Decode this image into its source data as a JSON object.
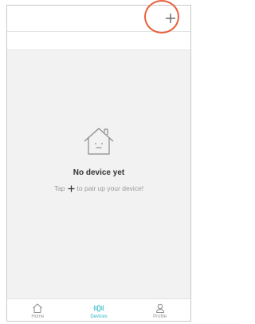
{
  "empty_state": {
    "title": "No device yet",
    "hint_prefix": "Tap",
    "hint_suffix": "to pair up your device!"
  },
  "tabs": [
    {
      "label": "Home",
      "icon": "home-icon",
      "active": false
    },
    {
      "label": "Devices",
      "icon": "devices-icon",
      "active": true
    },
    {
      "label": "Profile",
      "icon": "profile-icon",
      "active": false
    }
  ],
  "colors": {
    "accent": "#2bb7c7",
    "highlight": "#e8613c",
    "background": "#f2f2f2",
    "text_muted": "#9a9a9a"
  }
}
